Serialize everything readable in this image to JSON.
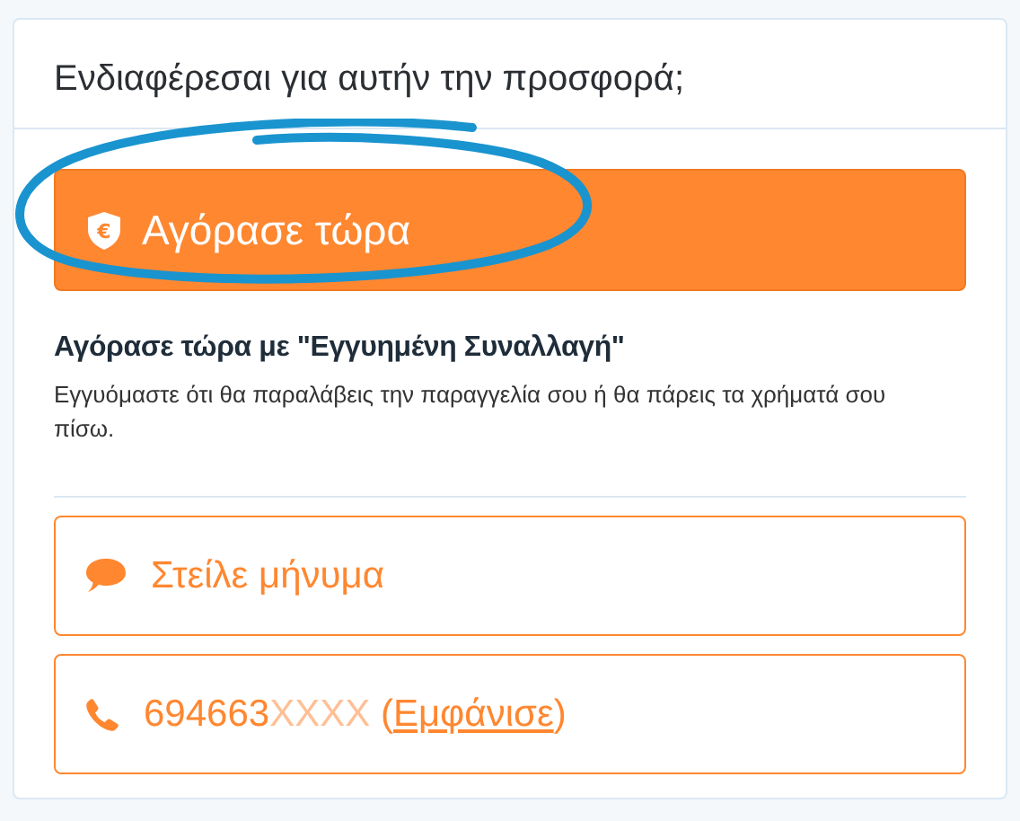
{
  "title": "Ενδιαφέρεσαι για αυτήν την προσφορά;",
  "buy_button": {
    "icon": "€",
    "label": "Αγόρασε τώρα",
    "highlighted": true
  },
  "guarantee": {
    "title": "Αγόρασε τώρα με \"Εγγυημένη Συναλλαγή\"",
    "text": "Εγγυόμαστε ότι θα παραλάβεις την παραγγελία σου ή θα πάρεις τα χρήματά σου πίσω."
  },
  "message_button": {
    "label": "Στείλε μήνυμα"
  },
  "phone_button": {
    "digits": "694663",
    "masked": "XXXX",
    "open": "(",
    "link": "Εμφάνισε",
    "close": ")"
  }
}
